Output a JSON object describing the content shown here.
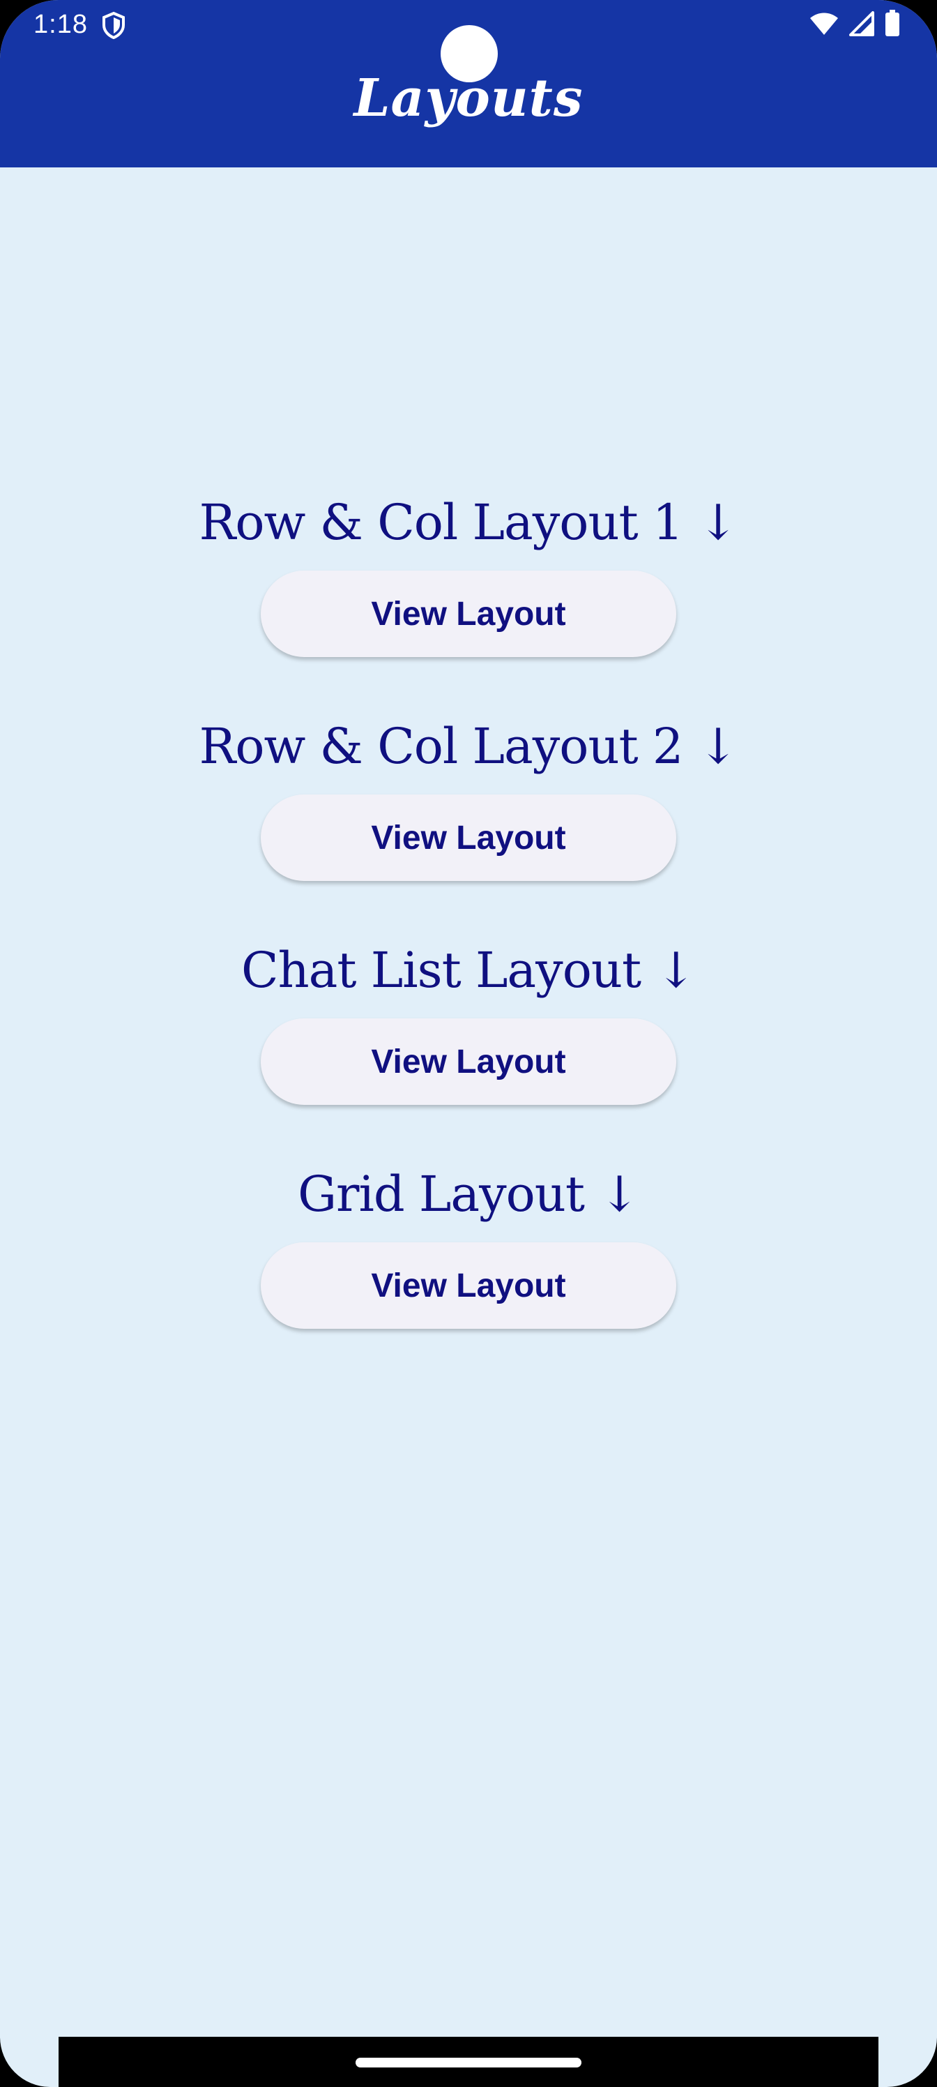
{
  "status_bar": {
    "time": "1:18",
    "icons": [
      "shield-icon",
      "wifi-icon",
      "signal-icon",
      "battery-icon"
    ]
  },
  "app_bar": {
    "title": "Layouts"
  },
  "sections": [
    {
      "title": "Row & Col Layout 1 ↓",
      "button_label": "View Layout"
    },
    {
      "title": "Row & Col Layout 2 ↓",
      "button_label": "View Layout"
    },
    {
      "title": "Chat List Layout ↓",
      "button_label": "View Layout"
    },
    {
      "title": "Grid Layout ↓",
      "button_label": "View Layout"
    }
  ],
  "colors": {
    "app_bar_bg": "#1535a5",
    "screen_bg": "#e1eff9",
    "title_text": "#0f1080",
    "button_bg": "#f2f1f8",
    "button_text": "#101080"
  }
}
